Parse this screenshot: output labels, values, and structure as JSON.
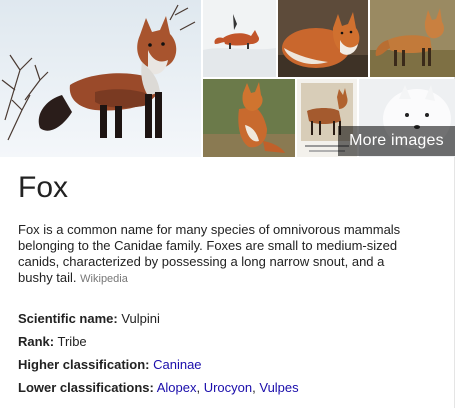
{
  "images": {
    "more_label": "More images"
  },
  "entity": {
    "title": "Fox",
    "description": "Fox is a common name for many species of omnivorous mammals belonging to the Canidae family. Foxes are small to medium-sized canids, characterized by possessing a long narrow snout, and a bushy tail.",
    "source": "Wikipedia"
  },
  "facts": {
    "scientific_name": {
      "label": "Scientific name:",
      "value": "Vulpini"
    },
    "rank": {
      "label": "Rank:",
      "value": "Tribe"
    },
    "higher_classification": {
      "label": "Higher classification:",
      "value": "Caninae"
    },
    "lower_classifications": {
      "label": "Lower classifications:",
      "values": [
        "Alopex",
        "Urocyon",
        "Vulpes"
      ]
    }
  },
  "colors": {
    "link": "#1a0dab",
    "text": "#222222",
    "muted": "#777777"
  }
}
